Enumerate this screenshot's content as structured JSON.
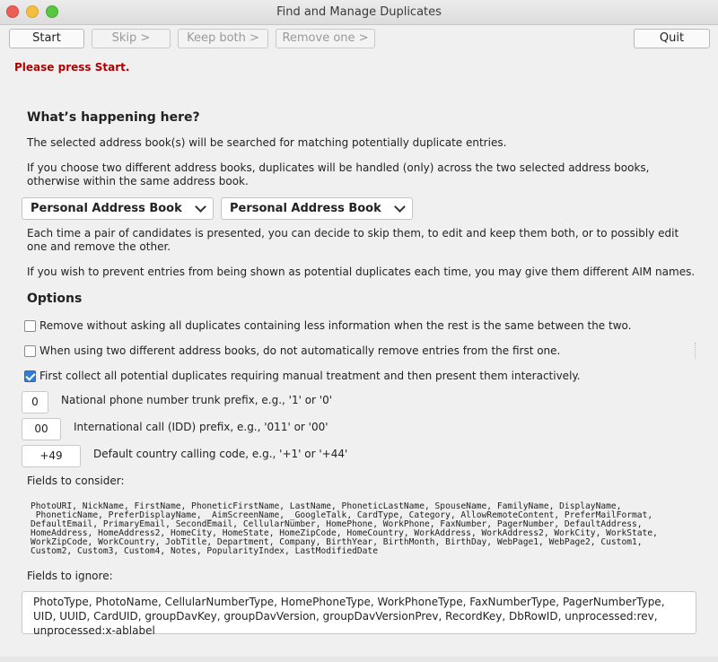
{
  "window": {
    "title": "Find and Manage Duplicates"
  },
  "toolbar": {
    "start_label": "Start",
    "skip_label": "Skip >",
    "keep_both_label": "Keep both >",
    "remove_one_label": "Remove one >",
    "quit_label": "Quit"
  },
  "status": {
    "message": "Please press Start.",
    "color": "#b00000"
  },
  "explanation": {
    "heading": "What’s happening here?",
    "para1": "The selected address book(s) will be searched for matching potentially duplicate entries.",
    "para2": "If you choose two different address books, duplicates will be handled (only) across the two selected address books, otherwise within the same address book.",
    "address_book_1": "Personal Address Book",
    "address_book_2": "Personal Address Book",
    "para3": "Each time a pair of candidates is presented, you can decide to skip them, to edit and keep them both, or to possibly edit one and remove the other.",
    "para4": "If you wish to prevent entries from being shown as potential duplicates each time, you may give them different AIM names."
  },
  "options": {
    "heading": "Options",
    "checkboxes": [
      {
        "label": "Remove without asking all duplicates containing less information when the rest is the same between the two.",
        "checked": false
      },
      {
        "label": "When using two different address books, do not automatically remove entries from the first one.",
        "checked": false
      },
      {
        "label": "First collect all potential duplicates requiring manual treatment and then present them interactively.",
        "checked": true
      }
    ],
    "trunk_prefix": {
      "value": "0",
      "label": "National phone number trunk prefix, e.g., '1' or '0'"
    },
    "idd_prefix": {
      "value": "00",
      "label": "International call (IDD) prefix, e.g., '011' or '00'"
    },
    "country_code": {
      "value": "+49",
      "label": "Default country calling code, e.g., '+1' or '+44'"
    },
    "fields_consider_label": "Fields to consider:",
    "fields_consider": "PhotoURI, NickName, FirstName, PhoneticFirstName, LastName, PhoneticLastName, SpouseName, FamilyName, DisplayName,\n PhoneticName, PreferDisplayName, _AimScreenName, _GoogleTalk, CardType, Category, AllowRemoteContent, PreferMailFormat,\nDefaultEmail, PrimaryEmail, SecondEmail, CellularNumber, HomePhone, WorkPhone, FaxNumber, PagerNumber, DefaultAddress,\nHomeAddress, HomeAddress2, HomeCity, HomeState, HomeZipCode, HomeCountry, WorkAddress, WorkAddress2, WorkCity, WorkState,\nWorkZipCode, WorkCountry, JobTitle, Department, Company, BirthYear, BirthMonth, BirthDay, WebPage1, WebPage2, Custom1,\nCustom2, Custom3, Custom4, Notes, PopularityIndex, LastModifiedDate",
    "fields_ignore_label": "Fields to ignore:",
    "fields_ignore": "PhotoType, PhotoName, CellularNumberType, HomePhoneType, WorkPhoneType, FaxNumberType, PagerNumberType, UID, UUID, CardUID, groupDavKey, groupDavVersion, groupDavVersionPrev, RecordKey, DbRowID, unprocessed:rev, unprocessed:x-ablabel"
  }
}
